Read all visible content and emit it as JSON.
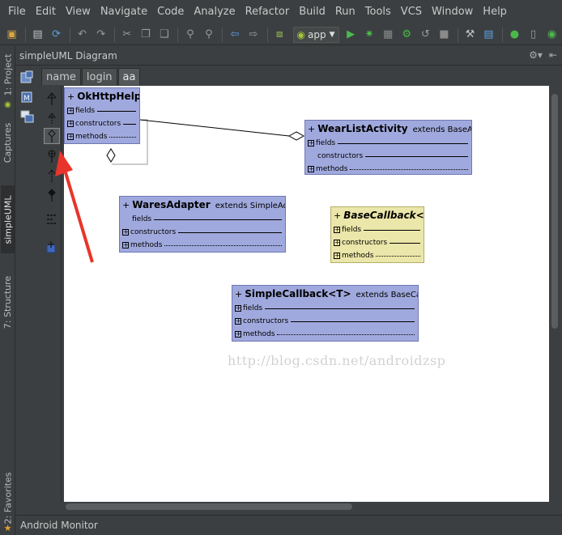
{
  "menu": [
    "File",
    "Edit",
    "View",
    "Navigate",
    "Code",
    "Analyze",
    "Refactor",
    "Build",
    "Run",
    "Tools",
    "VCS",
    "Window",
    "Help"
  ],
  "toolbar": {
    "run_config": "app"
  },
  "left_tabs": {
    "project": "1: Project",
    "captures": "Captures",
    "simpleuml": "simpleUML",
    "structure": "7: Structure",
    "favorites": "2: Favorites"
  },
  "panel": {
    "title": "simpleUML Diagram"
  },
  "tabs": [
    "name",
    "login",
    "aa"
  ],
  "diagram": {
    "okhttp": {
      "prefix": "+",
      "name": "OkHttpHelper",
      "rows": [
        "fields",
        "constructors",
        "methods"
      ]
    },
    "wearlist": {
      "prefix": "+",
      "name": "WearListActivity",
      "ext": "extends  BaseActiv...",
      "rows": [
        "fields",
        "constructors",
        "methods"
      ]
    },
    "wares": {
      "prefix": "+",
      "name": "WaresAdapter",
      "ext": "extends  SimpleAda...",
      "rows": [
        "fields",
        "constructors",
        "methods"
      ]
    },
    "basecb": {
      "prefix": "+",
      "name": "BaseCallback<T>",
      "rows": [
        "fields",
        "constructors",
        "methods"
      ]
    },
    "simplecb": {
      "prefix": "+",
      "name": "SimpleCallback<T>",
      "ext": "extends  BaseCallba...",
      "rows": [
        "fields",
        "constructors",
        "methods"
      ]
    }
  },
  "watermark": "http://blog.csdn.net/androidzsp",
  "bottom": {
    "label": "Android Monitor"
  }
}
